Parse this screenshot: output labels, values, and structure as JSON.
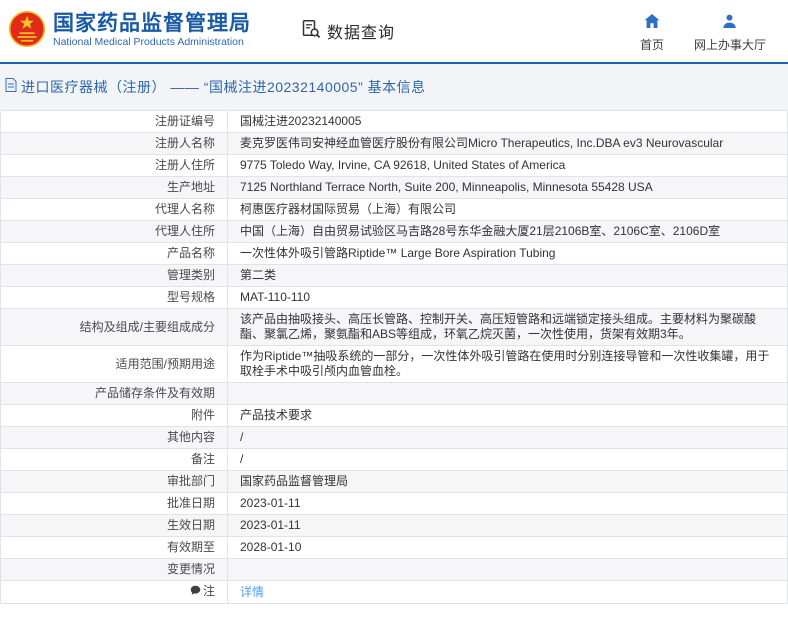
{
  "header": {
    "logo": {
      "emblem_icon": "china-national-emblem-icon",
      "title": "国家药品监督管理局",
      "subtitle": "National Medical Products Administration"
    },
    "data_query": {
      "icon": "doc-search-icon",
      "label": "数据查询"
    },
    "nav": [
      {
        "icon": "home-icon",
        "label": "首页"
      },
      {
        "icon": "person-icon",
        "label": "网上办事大厅"
      }
    ]
  },
  "breadcrumb": {
    "icon": "document-icon",
    "text": "进口医疗器械（注册） —— “国械注进20232140005” 基本信息"
  },
  "table": {
    "rows": [
      {
        "label": "注册证编号",
        "value": "国械注进20232140005"
      },
      {
        "label": "注册人名称",
        "value": "麦克罗医伟司安神经血管医疗股份有限公司Micro Therapeutics, Inc.DBA ev3 Neurovascular"
      },
      {
        "label": "注册人住所",
        "value": "9775 Toledo Way, Irvine, CA 92618, United States of America"
      },
      {
        "label": "生产地址",
        "value": "7125 Northland Terrace North, Suite 200, Minneapolis, Minnesota 55428 USA"
      },
      {
        "label": "代理人名称",
        "value": "柯惠医疗器材国际贸易（上海）有限公司"
      },
      {
        "label": "代理人住所",
        "value": "中国（上海）自由贸易试验区马吉路28号东华金融大厦21层2106B室、2106C室、2106D室"
      },
      {
        "label": "产品名称",
        "value": "一次性体外吸引管路Riptide™ Large Bore Aspiration Tubing"
      },
      {
        "label": "管理类别",
        "value": "第二类"
      },
      {
        "label": "型号规格",
        "value": "MAT-110-110"
      },
      {
        "label": "结构及组成/主要组成成分",
        "value": "该产品由抽吸接头、高压长管路、控制开关、高压短管路和远端锁定接头组成。主要材料为聚碳酸酯、聚氯乙烯，聚氨酯和ABS等组成，环氧乙烷灭菌，一次性使用，货架有效期3年。"
      },
      {
        "label": "适用范围/预期用途",
        "value": "作为Riptide™抽吸系统的一部分，一次性体外吸引管路在使用时分别连接导管和一次性收集罐，用于取栓手术中吸引颅内血管血栓。"
      },
      {
        "label": "产品储存条件及有效期",
        "value": ""
      },
      {
        "label": "附件",
        "value": "产品技术要求"
      },
      {
        "label": "其他内容",
        "value": "/"
      },
      {
        "label": "备注",
        "value": "/"
      },
      {
        "label": "审批部门",
        "value": "国家药品监督管理局"
      },
      {
        "label": "批准日期",
        "value": "2023-01-11"
      },
      {
        "label": "生效日期",
        "value": "2023-01-11"
      },
      {
        "label": "有效期至",
        "value": "2028-01-10"
      },
      {
        "label": "变更情况",
        "value": ""
      },
      {
        "label": "注",
        "value": "详情",
        "link": true,
        "label_icon": "note-icon"
      }
    ]
  },
  "colors": {
    "brand_blue": "#1a5aa5",
    "rule_blue": "#1b60ae",
    "nav_icon_blue": "#2d6fc3",
    "link_blue": "#4f9ff0",
    "emblem_red": "#e02a1a",
    "emblem_gold": "#f6c324",
    "row_alt_bg": "#f6f6f9",
    "border_gray": "#e2e3e9"
  }
}
